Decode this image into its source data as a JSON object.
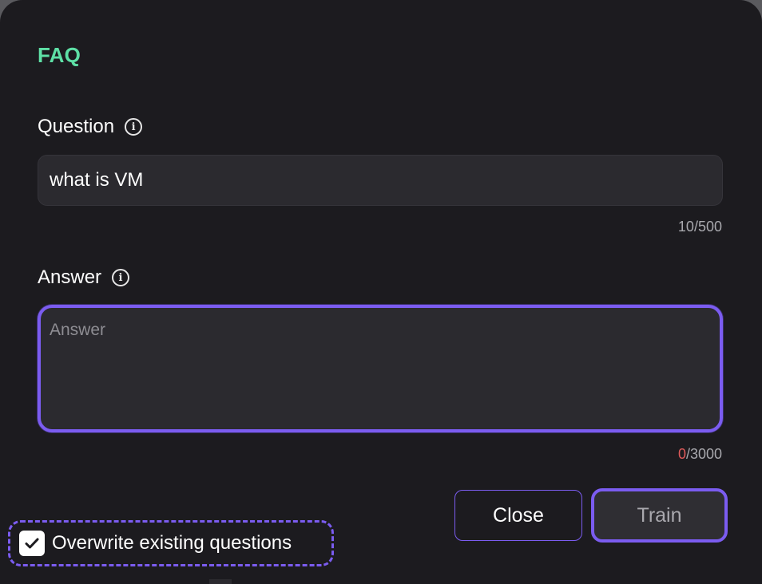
{
  "dialog": {
    "title": "FAQ"
  },
  "question": {
    "label": "Question",
    "value": "what is VM",
    "counter_current": "10",
    "counter_max": "/500"
  },
  "answer": {
    "label": "Answer",
    "placeholder": "Answer",
    "value": "",
    "counter_current": "0",
    "counter_max": "/3000"
  },
  "buttons": {
    "close_label": "Close",
    "train_label": "Train"
  },
  "overwrite": {
    "label": "Overwrite existing questions",
    "checked": true
  },
  "icons": {
    "info": "info-icon",
    "check": "check-icon"
  },
  "colors": {
    "accent": "#7b5cf0",
    "title": "#5ee0a6",
    "error_count": "#e05a5a",
    "background": "#1c1b1f"
  }
}
